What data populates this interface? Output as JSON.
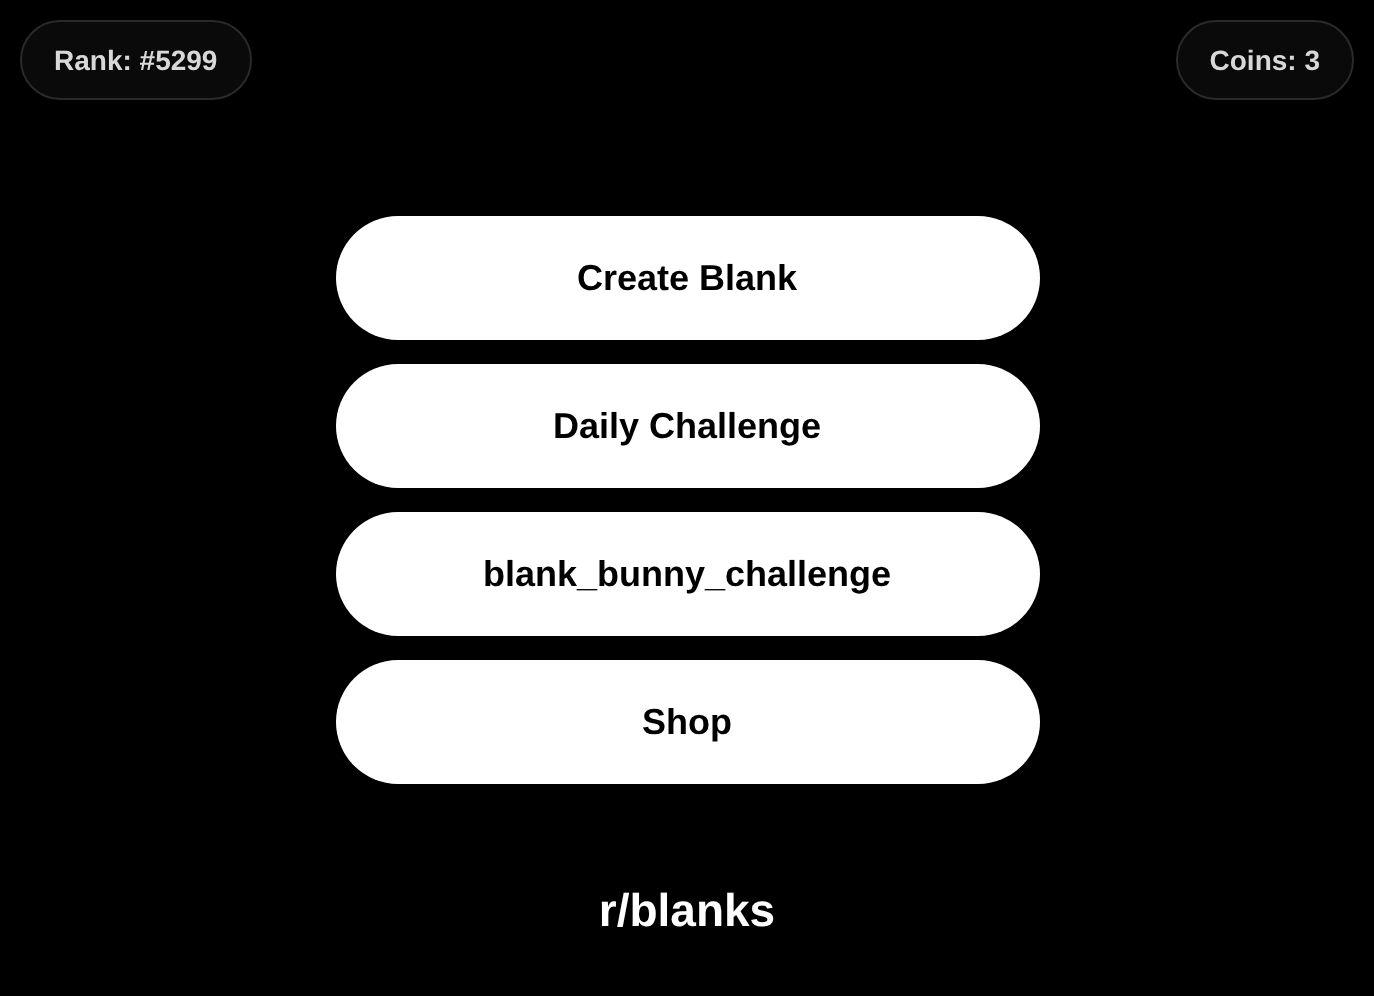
{
  "header": {
    "rank": "Rank: #5299",
    "coins": "Coins: 3"
  },
  "menu": [
    {
      "label": "Create Blank"
    },
    {
      "label": "Daily Challenge"
    },
    {
      "label": "blank_bunny_challenge"
    },
    {
      "label": "Shop"
    }
  ],
  "footer": {
    "title": "r/blanks"
  }
}
